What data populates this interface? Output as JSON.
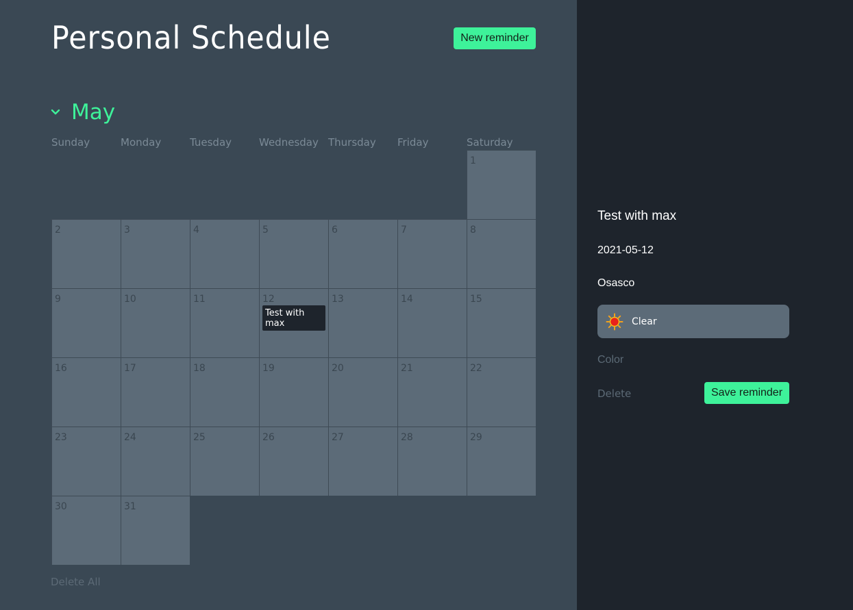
{
  "header": {
    "title": "Personal Schedule",
    "new_reminder_label": "New reminder"
  },
  "calendar": {
    "month": "May",
    "weekdays": [
      "Sunday",
      "Monday",
      "Tuesday",
      "Wednesday",
      "Thursday",
      "Friday",
      "Saturday"
    ],
    "first_weekday_index": 6,
    "days_in_month": 31,
    "reminders": [
      {
        "day": 12,
        "text": "Test with max"
      }
    ],
    "delete_all_label": "Delete All"
  },
  "detail": {
    "title": "Test with max",
    "date": "2021-05-12",
    "city": "Osasco",
    "weather": "Clear",
    "weather_icon": "sun-icon",
    "color_label": "Color",
    "delete_label": "Delete",
    "save_label": "Save reminder"
  },
  "colors": {
    "background": "#3a4854",
    "panel": "#1e242c",
    "cell": "#5c6b78",
    "accent": "#3ef29a",
    "muted_text": "#5c6a76"
  }
}
